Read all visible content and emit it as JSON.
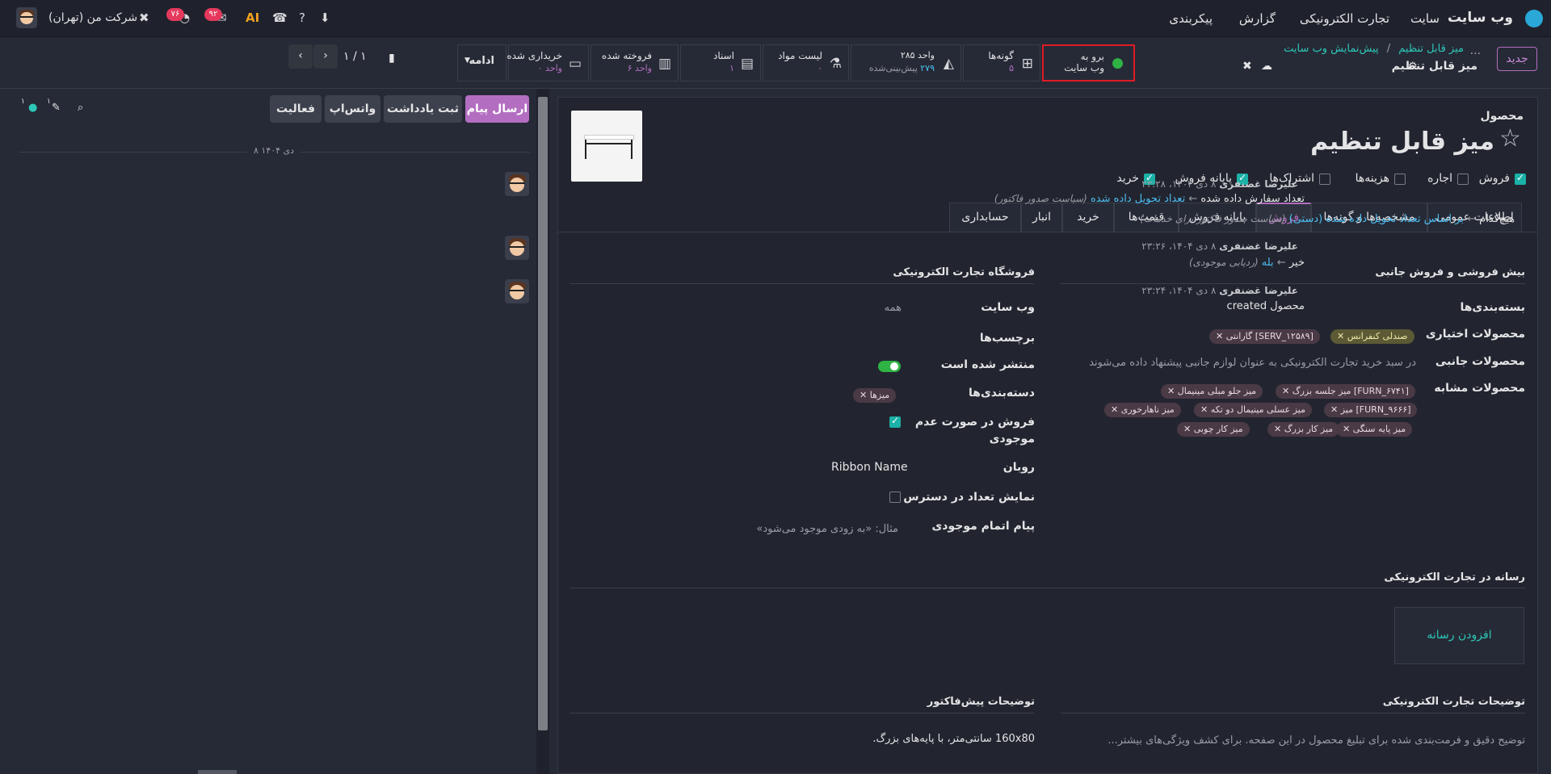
{
  "topbar": {
    "app_name": "وب سایت",
    "menu": [
      "سایت",
      "تجارت الکترونیکی",
      "گزارش",
      "پیکربندی"
    ],
    "company": "شرکت من (تهران)",
    "badge_activities": "۷۶",
    "badge_messages": "۹۲"
  },
  "breadcrumb": {
    "new_button": "جدید",
    "ellipsis": "...",
    "crumbs": [
      "میز قابل تنظیم",
      "پیش‌نمایش وب سایت"
    ],
    "separator": "/",
    "current": "میز قابل تنظیم"
  },
  "smart_buttons": {
    "goto_website": {
      "line1": "برو به",
      "line2": "وب سایت"
    },
    "variants": {
      "label": "گونه‌ها",
      "value": "۵"
    },
    "forecast": {
      "line1": "۲۸۵ واحد",
      "line2_num": "۲۷۹",
      "line2_text": "پیش‌بینی‌شده"
    },
    "bom": {
      "label": "لیست مواد",
      "value": "۰"
    },
    "documents": {
      "label": "اسناد",
      "value": "۱"
    },
    "sold": {
      "label": "فروخته شده",
      "value": "۶ واحد"
    },
    "purchased": {
      "label": "خریداری شده",
      "value": "۰ واحد"
    },
    "more": "ادامه"
  },
  "pager": {
    "value": "۱ / ۱"
  },
  "form": {
    "type_label": "محصول",
    "product_name": "میز قابل تنظیم",
    "options": [
      {
        "label": "فروش",
        "checked": true
      },
      {
        "label": "اجاره",
        "checked": false
      },
      {
        "label": "هزینه‌ها",
        "checked": false
      },
      {
        "label": "اشتراک‌ها",
        "checked": false
      },
      {
        "label": "پایانه فروش",
        "checked": true
      },
      {
        "label": "خرید",
        "checked": true
      }
    ],
    "tabs": [
      "اطلاعات عمومی",
      "مشخصه‌ها و گونه‌ها",
      "فروش",
      "پایانه فروش",
      "قیمت‌ها",
      "خرید",
      "انبار",
      "حسابداری"
    ],
    "active_tab": "فروش"
  },
  "upsell": {
    "title": "بیش فروشی و فروش جانبی",
    "packaging_label": "بسته‌بندی‌ها",
    "optional_label": "محصولات اختیاری",
    "optional_tags": [
      "صندلی کنفرانس",
      "[SERV_۱۲۵۸۹] گارانتی"
    ],
    "accessory_label": "محصولات جانبی",
    "accessory_placeholder": "در سبد خرید تجارت الکترونیکی به عنوان لوازم جانبی پیشنهاد داده می‌شوند",
    "similar_label": "محصولات مشابه",
    "similar_tags": [
      "[FURN_۶۷۴۱] میز جلسه بزرگ",
      "میز جلو مبلی مینیمال",
      "[FURN_۹۶۶۶] میز",
      "میز عسلی مینیمال دو تکه",
      "میز ناهارخوری",
      "میز پایه سنگی",
      "میز کار بزرگ",
      "میز کار چوبی"
    ]
  },
  "shop": {
    "title": "فروشگاه تجارت الکترونیکی",
    "website_label": "وب سایت",
    "website_value": "همه",
    "tags_label": "برچسب‌ها",
    "published_label": "منتشر شده است",
    "categories_label": "دسته‌بندی‌ها",
    "category_tag": "میزها",
    "oos_label_1": "فروش در صورت عدم",
    "oos_label_2": "موجودی",
    "ribbon_label": "روبان",
    "ribbon_value": "Ribbon Name",
    "show_qty_label": "نمایش تعداد در دسترس",
    "oos_msg_label": "پیام اتمام موجودی",
    "oos_msg_placeholder": "مثال: «به زودی موجود می‌شود»"
  },
  "media": {
    "title": "رسانه در تجارت الکترونیکی",
    "add_button": "افزودن رسانه"
  },
  "ecom_desc": {
    "title": "توضیحات تجارت الکترونیکی",
    "placeholder": "توضیح دقیق و فرمت‌بندی شده برای تبلیغ محصول در این صفحه. برای کشف ویژگی‌های بیشتر..."
  },
  "quote_desc": {
    "title": "توضیحات پیش‌فاکتور",
    "value": "160x80 سانتی‌متر، با پایه‌های بزرگ."
  },
  "chatter": {
    "send_message": "ارسال پیام",
    "log_note": "ثبت یادداشت",
    "whatsapp": "واتس‌اپ",
    "activity": "فعالیت",
    "attach_count": "۱",
    "follower_count": "۱",
    "date_sep": "۸ دی ۱۴۰۴",
    "messages": [
      {
        "author": "علیرضا غضنفری",
        "date": "۸ دی ۱۴۰۴، ۲۳:۲۸",
        "l1_old": "تعداد سفارش داده شده",
        "l1_new": "تعداد تحویل داده شده",
        "l1_field": "(سیاست صدور فاکتور)",
        "l2_old": "هیچ‌کدام",
        "l2_new": "بر اساس تعداد تحویل داده شده (دستی)",
        "l2_field": "(سیاست صدور فاکتور برای خدمات)"
      },
      {
        "author": "علیرضا غضنفری",
        "date": "۸ دی ۱۴۰۴، ۲۳:۲۶",
        "l1_old": "خیر",
        "l1_new": "بله",
        "l1_field": "(ردیابی موجودی)"
      },
      {
        "author": "علیرضا غضنفری",
        "date": "۸ دی ۱۴۰۴، ۲۳:۲۴",
        "body": "محصول created"
      }
    ]
  }
}
